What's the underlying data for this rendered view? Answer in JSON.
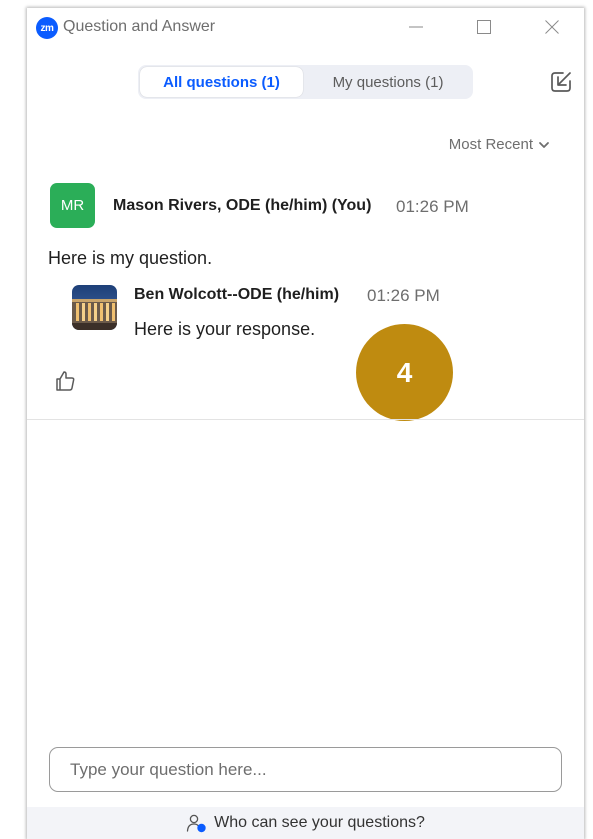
{
  "window": {
    "logo_text": "zm",
    "title": "Question and Answer"
  },
  "tabs": [
    {
      "label": "All questions (1)",
      "active": true
    },
    {
      "label": "My questions (1)",
      "active": false
    }
  ],
  "sort": {
    "label": "Most Recent"
  },
  "question": {
    "avatar_initials": "MR",
    "avatar_color": "#2bae58",
    "author": "Mason Rivers, ODE (he/him) (You)",
    "time": "01:26 PM",
    "text": "Here is my question."
  },
  "answer": {
    "author": "Ben Wolcott--ODE (he/him)",
    "time": "01:26 PM",
    "text": "Here is your response."
  },
  "step_badge": {
    "label": "4",
    "color": "#bf8b10"
  },
  "input": {
    "placeholder": "Type your question here...",
    "value": ""
  },
  "footer": {
    "label": "Who can see your questions?"
  },
  "colors": {
    "accent": "#0b5cff",
    "badge": "#bf8b10"
  }
}
